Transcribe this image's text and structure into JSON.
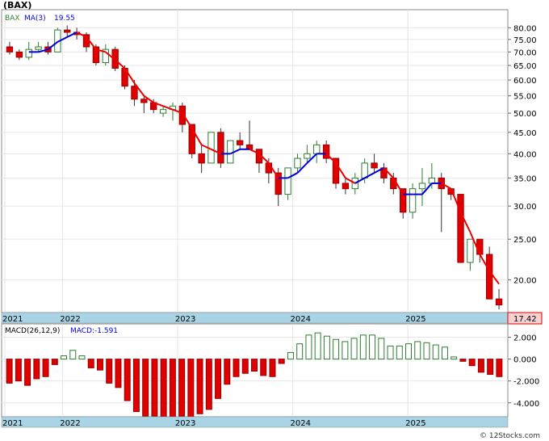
{
  "title": "(BAX)",
  "legend": {
    "ticker": "BAX",
    "ma_label": "MA(3)",
    "ma_value": "19.55"
  },
  "last_price_label": "17.42",
  "macd_legend": {
    "label": "MACD(26,12,9)",
    "value_label": "MACD:-1.591"
  },
  "watermark": "© 12Stocks.com",
  "colors": {
    "up": "#2e7d32",
    "down": "#e00000",
    "ma_up": "#0000dd",
    "ma_down": "#ee0000",
    "axis_band": "#a8d4e6",
    "price_box": "#f7d0d0"
  },
  "chart_data": [
    {
      "type": "candlestick",
      "scale": "log",
      "ylim": [
        17,
        86
      ],
      "y_ticks": [
        "80.00",
        "75.00",
        "70.00",
        "65.00",
        "60.00",
        "55.00",
        "50.00",
        "45.00",
        "40.00",
        "35.00",
        "30.00",
        "25.00",
        "20.00"
      ],
      "y_tick_values": [
        80,
        75,
        70,
        65,
        60,
        55,
        50,
        45,
        40,
        35,
        30,
        25,
        20
      ],
      "x_labels": [
        "2021",
        "2022",
        "2023",
        "2024",
        "2025"
      ],
      "x_label_index": [
        0,
        6,
        18,
        30,
        42
      ],
      "months": 52,
      "ohlc": [
        [
          72,
          74,
          69,
          70
        ],
        [
          70,
          71,
          67,
          68
        ],
        [
          68,
          74,
          67,
          71
        ],
        [
          71,
          74,
          70,
          72
        ],
        [
          72,
          74,
          69,
          70
        ],
        [
          70,
          80,
          70,
          79
        ],
        [
          79,
          81,
          76,
          78
        ],
        [
          78,
          80,
          75,
          77
        ],
        [
          77,
          78,
          70,
          72
        ],
        [
          72,
          73,
          65,
          66
        ],
        [
          66,
          73,
          65,
          71
        ],
        [
          71,
          72,
          63,
          64
        ],
        [
          64,
          65,
          57,
          58
        ],
        [
          58,
          60,
          52,
          54
        ],
        [
          54,
          55,
          50,
          53
        ],
        [
          53,
          54,
          50,
          51
        ],
        [
          50,
          52,
          49,
          51
        ],
        [
          51,
          53,
          48,
          52
        ],
        [
          52,
          53,
          45,
          47
        ],
        [
          47,
          47,
          39,
          40
        ],
        [
          40,
          42,
          36,
          38
        ],
        [
          38,
          45,
          38,
          45
        ],
        [
          45,
          46,
          37,
          38
        ],
        [
          38,
          43,
          38,
          43
        ],
        [
          43,
          45,
          41,
          42
        ],
        [
          42,
          48,
          41,
          41
        ],
        [
          41,
          41,
          36,
          38
        ],
        [
          38,
          39,
          34,
          36
        ],
        [
          36,
          37,
          30,
          32
        ],
        [
          32,
          37,
          31,
          37
        ],
        [
          37,
          40,
          36,
          39
        ],
        [
          39,
          42,
          38,
          40
        ],
        [
          40,
          43,
          38,
          42
        ],
        [
          42,
          43,
          38,
          39
        ],
        [
          39,
          39,
          33,
          34
        ],
        [
          34,
          35,
          32,
          33
        ],
        [
          33,
          36,
          32,
          35
        ],
        [
          35,
          39,
          34,
          38
        ],
        [
          38,
          40,
          36,
          37
        ],
        [
          37,
          38,
          34,
          35
        ],
        [
          35,
          36,
          32,
          33
        ],
        [
          33,
          33,
          28,
          29
        ],
        [
          29,
          34,
          28,
          33
        ],
        [
          33,
          37,
          30,
          34
        ],
        [
          34,
          38,
          33,
          35
        ],
        [
          35,
          36,
          26,
          33
        ],
        [
          33,
          33,
          31,
          32
        ],
        [
          32,
          32,
          22,
          22
        ],
        [
          22,
          25,
          21,
          25
        ],
        [
          25,
          25,
          22,
          23
        ],
        [
          23,
          24,
          18,
          18
        ],
        [
          18,
          19,
          17,
          17.42
        ]
      ],
      "ma3": [
        null,
        null,
        70,
        70,
        71,
        74,
        76,
        78,
        76,
        71,
        70,
        67,
        64,
        59,
        55,
        53,
        52,
        51,
        50,
        46,
        42,
        41,
        40,
        40,
        41,
        41,
        40,
        38,
        35,
        35,
        36,
        38,
        40,
        40,
        38,
        35,
        34,
        35,
        36,
        37,
        35,
        32,
        32,
        32,
        34,
        34,
        33,
        29,
        26,
        23,
        21,
        19.55
      ]
    },
    {
      "type": "bar",
      "ylim": [
        -5.2,
        3.0
      ],
      "y_ticks": [
        "2.000",
        "0.000",
        "-2.000",
        "-4.000"
      ],
      "y_tick_values": [
        2,
        0,
        -2,
        -4
      ],
      "x_labels": [
        "2021",
        "2022",
        "2023",
        "2024",
        "2025"
      ],
      "values": [
        -2.2,
        -2.0,
        -2.4,
        -1.8,
        -1.6,
        -0.5,
        0.3,
        0.8,
        0.3,
        -0.8,
        -1.0,
        -2.2,
        -2.6,
        -3.8,
        -4.8,
        -5.2,
        -5.2,
        -5.3,
        -5.3,
        -5.2,
        -5.4,
        -5.0,
        -4.6,
        -3.6,
        -2.3,
        -1.6,
        -1.3,
        -1.1,
        -1.5,
        -1.6,
        -0.4,
        0.6,
        1.4,
        2.2,
        2.4,
        2.1,
        1.8,
        1.6,
        1.9,
        2.2,
        2.2,
        1.9,
        1.2,
        1.2,
        1.4,
        1.6,
        1.5,
        1.3,
        1.1,
        0.2,
        -0.2,
        -0.6,
        -1.2,
        -1.4,
        -1.6
      ]
    }
  ]
}
